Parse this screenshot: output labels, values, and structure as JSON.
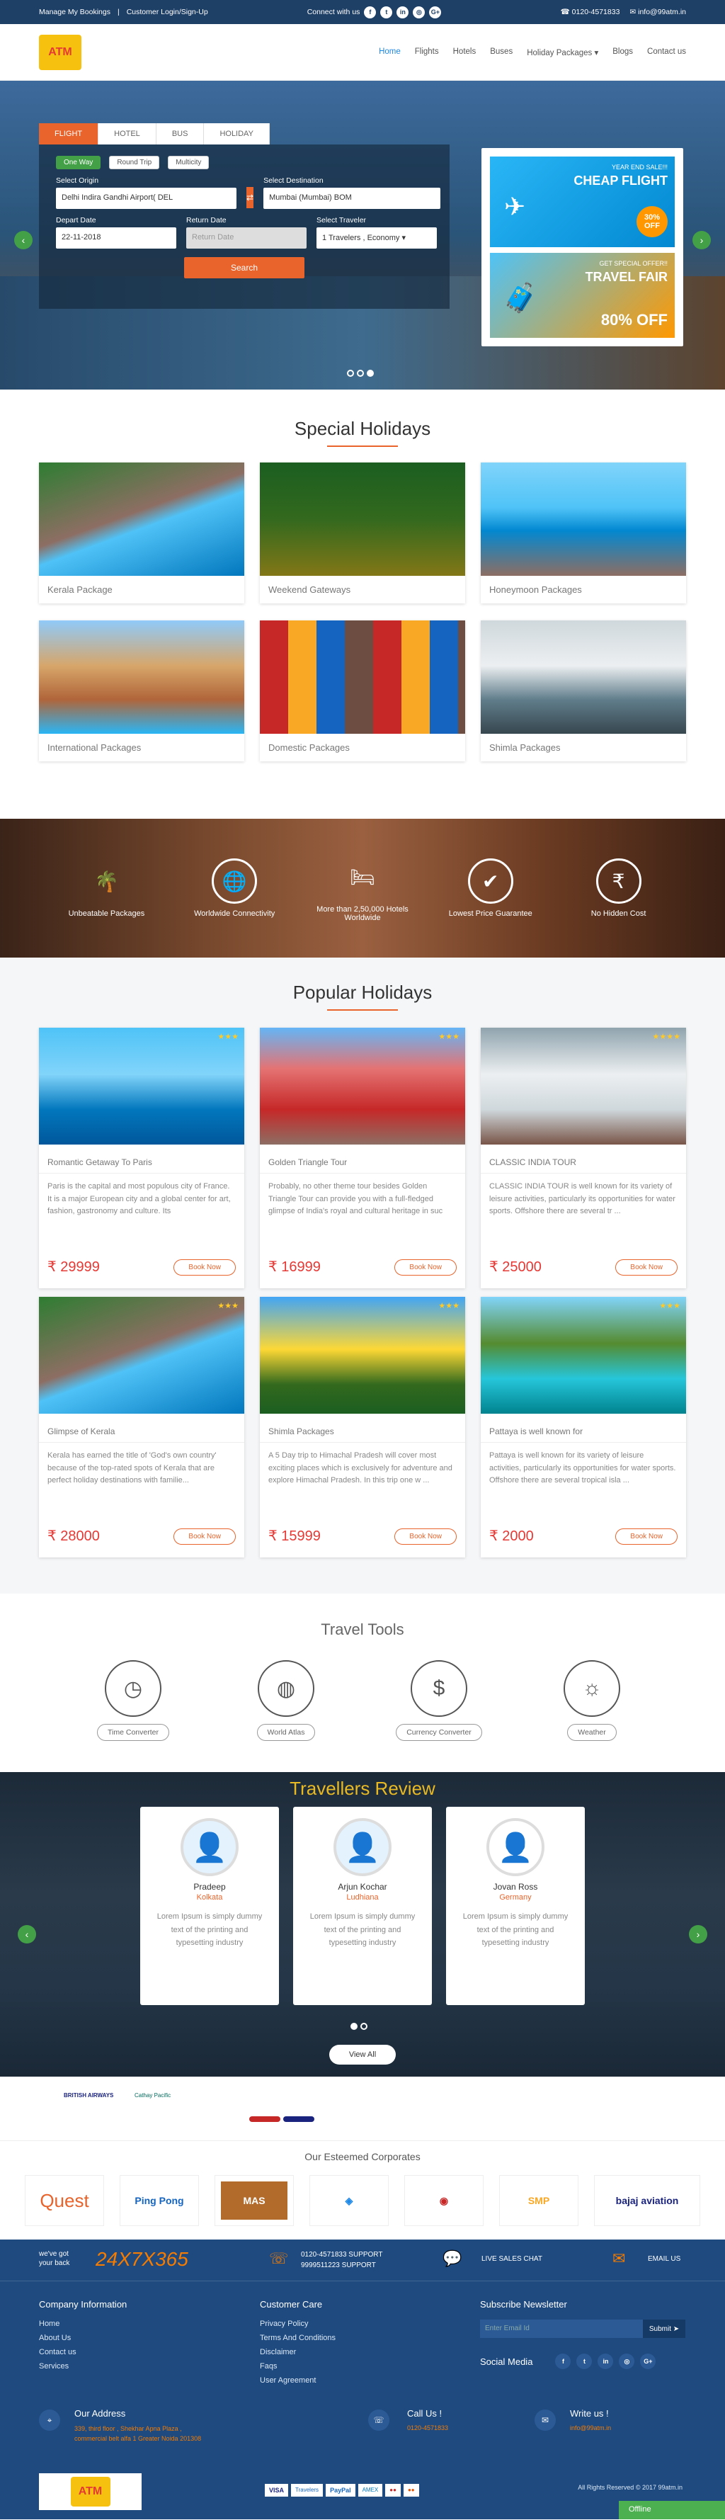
{
  "topbar": {
    "bookings": "Manage My Bookings",
    "login": "Customer Login/Sign-Up",
    "connect": "Connect with us",
    "phone": "0120-4571833",
    "email": "info@99atm.in"
  },
  "logo": {
    "text": "ATM"
  },
  "nav": [
    "Home",
    "Flights",
    "Hotels",
    "Buses",
    "Holiday Packages ▾",
    "Blogs",
    "Contact us"
  ],
  "search": {
    "tabs": [
      "FLIGHT",
      "HOTEL",
      "BUS",
      "HOLIDAY"
    ],
    "trip": [
      "One Way",
      "Round Trip",
      "Multicity"
    ],
    "origin_label": "Select Origin",
    "origin": "Delhi Indira Gandhi Airport( DEL",
    "dest_label": "Select Destination",
    "dest": "Mumbai (Mumbai) BOM",
    "depart_label": "Depart Date",
    "depart": "22-11-2018",
    "return_label": "Return Date",
    "return": "Return Date",
    "traveller_label": "Select Traveler",
    "traveller": "1 Travelers , Economy",
    "button": "Search"
  },
  "promo": {
    "p1a": "YEAR END SALE!!!",
    "p1b": "CHEAP FLIGHT",
    "p1c": "30% OFF",
    "p2a": "GET SPECIAL OFFER!!",
    "p2b": "TRAVEL FAIR",
    "p2c": "80% OFF"
  },
  "special": {
    "title": "Special Holidays",
    "items": [
      "Kerala Package",
      "Weekend Gateways",
      "Honeymoon Packages",
      "International Packages",
      "Domestic Packages",
      "Shimla Packages"
    ]
  },
  "usp": [
    "Unbeatable Packages",
    "Worldwide Connectivity",
    "More than 2,50,000 Hotels Worldwide",
    "Lowest Price Guarantee",
    "No Hidden Cost"
  ],
  "popular": {
    "title": "Popular Holidays",
    "book": "Book Now",
    "items": [
      {
        "title": "Romantic Getaway To Paris",
        "desc": "Paris is the capital and most populous city of France. It is a major European city and a global center for art, fashion, gastronomy and culture. Its",
        "price": "₹ 29999"
      },
      {
        "title": "Golden Triangle Tour",
        "desc": "Probably, no other theme tour besides Golden Triangle Tour can provide you with a full-fledged glimpse of India's royal and cultural heritage in suc",
        "price": "₹ 16999"
      },
      {
        "title": "CLASSIC INDIA TOUR",
        "desc": "CLASSIC INDIA TOUR is well known for its variety of leisure activities, particularly its opportunities for water sports. Offshore there are several tr ...",
        "price": "₹ 25000"
      },
      {
        "title": "Glimpse of Kerala",
        "desc": "Kerala has earned the title of 'God's own country' because of the top-rated spots of Kerala that are perfect holiday destinations with familie...",
        "price": "₹ 28000"
      },
      {
        "title": "Shimla Packages",
        "desc": "A 5 Day trip to Himachal Pradesh will cover most exciting places which is exclusively for adventure and explore Himachal Pradesh. In this trip one w ...",
        "price": "₹ 15999"
      },
      {
        "title": "Pattaya is well known for",
        "desc": "Pattaya is well known for its variety of leisure activities, particularly its opportunities for water sports. Offshore there are several tropical isla ...",
        "price": "₹ 2000"
      }
    ]
  },
  "tools": {
    "title": "Travel Tools",
    "items": [
      "Time Converter",
      "World Atlas",
      "Currency Converter",
      "Weather"
    ]
  },
  "reviews": {
    "title": "Travellers Review",
    "items": [
      {
        "name": "Pradeep",
        "loc": "Kolkata",
        "text": "Lorem Ipsum is simply dummy text of the printing and typesetting industry"
      },
      {
        "name": "Arjun Kochar",
        "loc": "Ludhiana",
        "text": "Lorem Ipsum is simply dummy text of the printing and typesetting industry"
      },
      {
        "name": "Jovan Ross",
        "loc": "Germany",
        "text": "Lorem Ipsum is simply dummy text of the printing and typesetting industry"
      }
    ],
    "view_all": "View All"
  },
  "airlines": {
    "a1": "BRITISH AIRWAYS",
    "a2": "Cathay Pacific"
  },
  "corporates": {
    "title": "Our Esteemed Corporates",
    "items": [
      "Quest",
      "Ping Pong",
      "MAS",
      "",
      "",
      "SMP",
      "bajaj aviation"
    ]
  },
  "footer": {
    "support_a": "we've got",
    "support_b": "your back",
    "hours": "24X7X365",
    "ph1": "0120-4571833",
    "ph2": "9999511223",
    "support": "SUPPORT",
    "chat": "LIVE SALES CHAT",
    "email": "EMAIL US",
    "company_title": "Company Information",
    "company": [
      "Home",
      "About Us",
      "Contact us",
      "Services"
    ],
    "care_title": "Customer Care",
    "care": [
      "Privacy Policy",
      "Terms And Conditions",
      "Disclaimer",
      "Faqs",
      "User Agreement"
    ],
    "news_title": "Subscribe Newsletter",
    "news_placeholder": "Enter Email Id",
    "news_btn": "Submit",
    "social": "Social Media",
    "addr_title": "Our Address",
    "addr": "339, third floor , Shekhar Apna Plaza , commercial belt alfa 1 Greater Noida 201308",
    "call_title": "Call Us !",
    "call": "0120-4571833",
    "write_title": "Write us !",
    "write": "info@99atm.in",
    "rights": "All Rights Reserved © 2017 99atm.in",
    "offline": "Offline"
  }
}
